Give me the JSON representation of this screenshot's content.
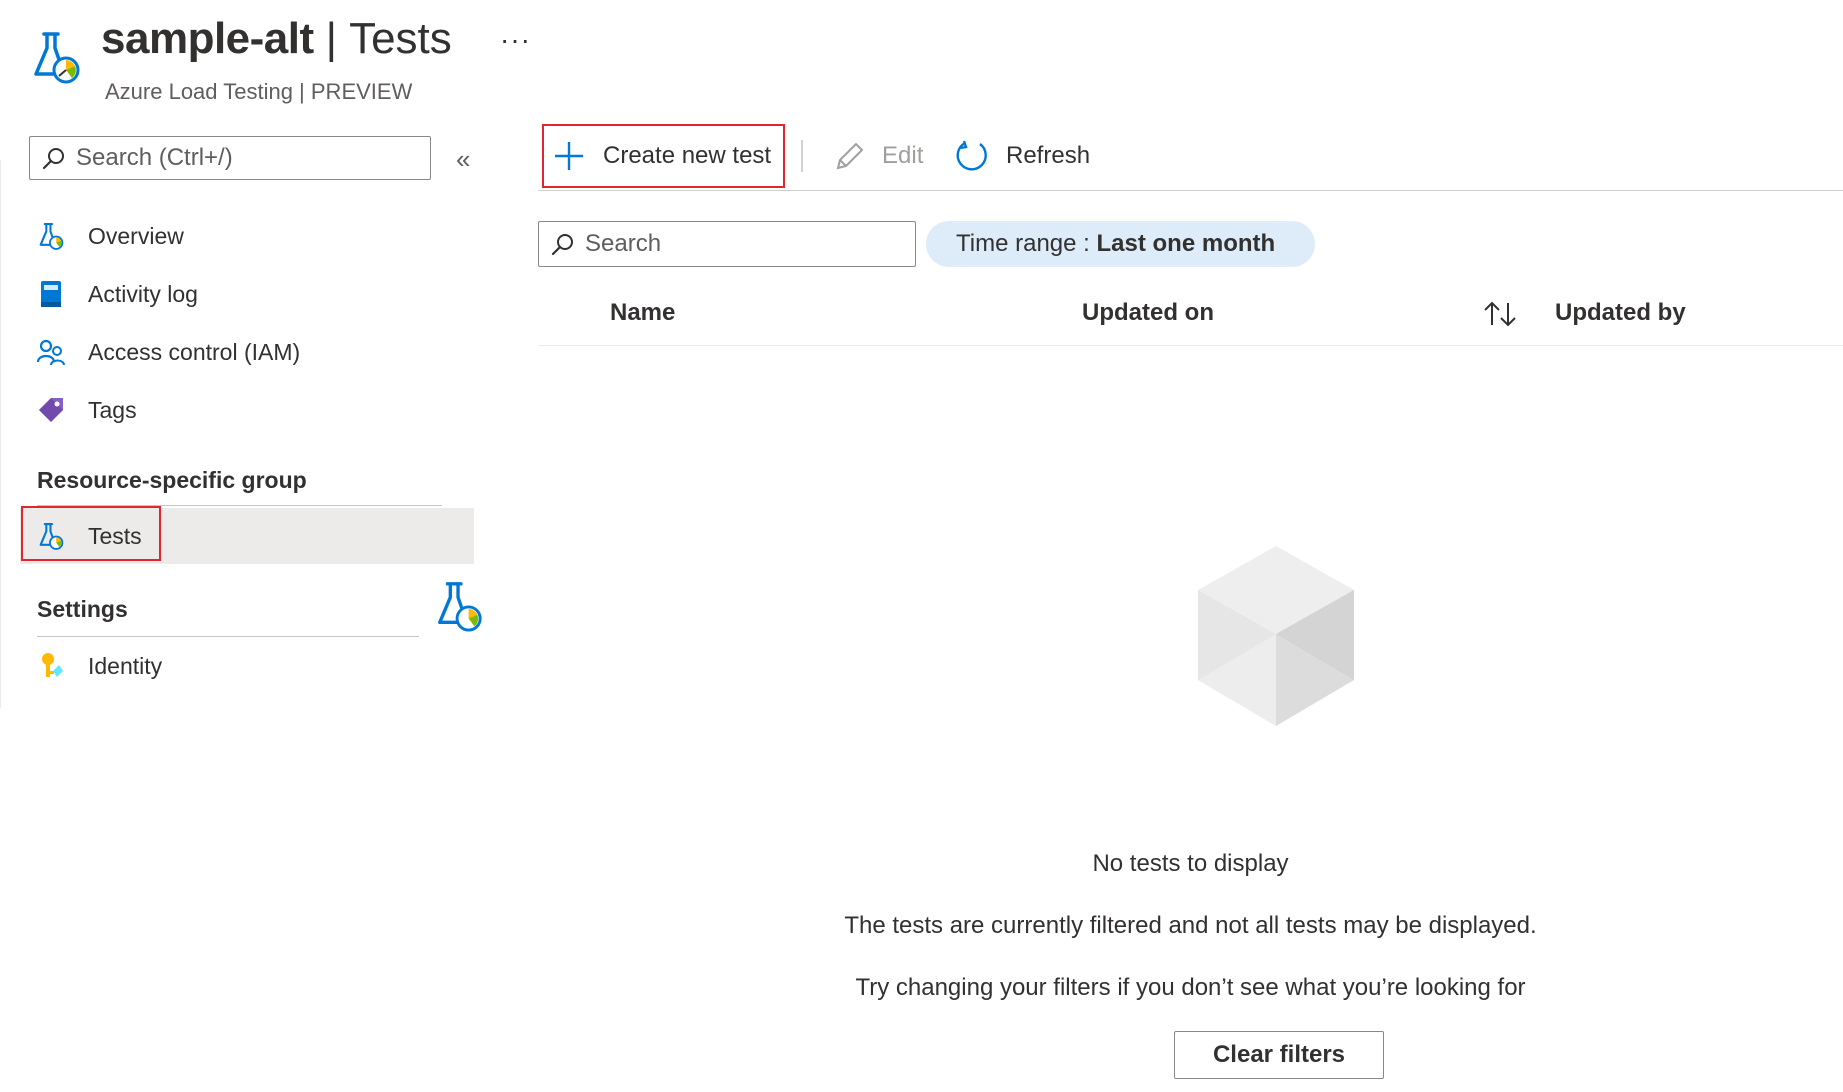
{
  "header": {
    "resource_name": "sample-alt",
    "separator": "|",
    "page_title": "Tests",
    "more_label": "···",
    "subtitle": "Azure Load Testing | PREVIEW"
  },
  "sidebar": {
    "search_placeholder": "Search (Ctrl+/)",
    "collapse_label": "«",
    "items": [
      {
        "label": "Overview",
        "icon": "load-testing-icon"
      },
      {
        "label": "Activity log",
        "icon": "activity-log-icon"
      },
      {
        "label": "Access control (IAM)",
        "icon": "iam-people-icon"
      },
      {
        "label": "Tags",
        "icon": "tag-icon"
      }
    ],
    "groups": [
      {
        "title": "Resource-specific group",
        "items": [
          {
            "label": "Tests",
            "icon": "load-testing-icon",
            "selected": true
          }
        ]
      },
      {
        "title": "Settings",
        "items": [
          {
            "label": "Identity",
            "icon": "key-identity-icon"
          }
        ]
      }
    ]
  },
  "toolbar": {
    "create_label": "Create new test",
    "edit_label": "Edit",
    "refresh_label": "Refresh"
  },
  "filters": {
    "search_placeholder": "Search",
    "time_range_label": "Time range : ",
    "time_range_value": "Last one month"
  },
  "table": {
    "columns": [
      "Name",
      "Updated on",
      "Updated by"
    ]
  },
  "empty_state": {
    "title": "No tests to display",
    "line1": "The tests are currently filtered and not all tests may be displayed.",
    "line2": "Try changing your filters if you don’t see what you’re looking for",
    "button_label": "Clear filters"
  },
  "colors": {
    "accent": "#0078d4",
    "highlight_box": "#e3252f",
    "selected_bg": "#edebe9",
    "pill_bg": "#deecf9"
  }
}
